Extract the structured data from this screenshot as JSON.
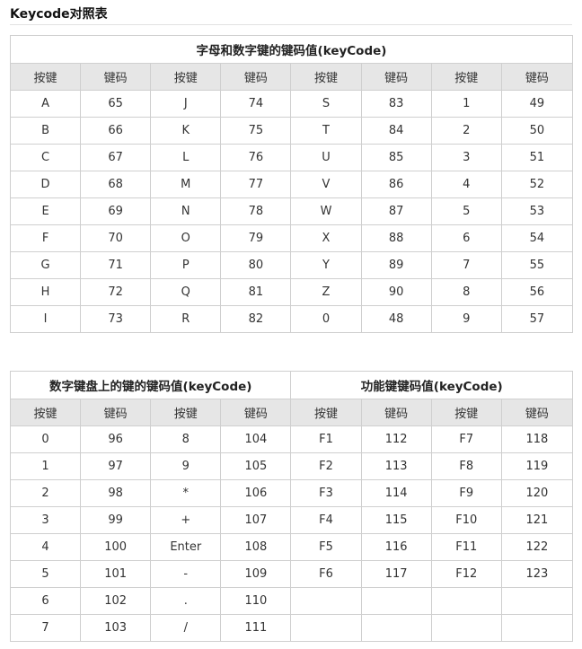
{
  "page_title": "Keycode对照表",
  "table1": {
    "caption": "字母和数字键的键码值(keyCode)",
    "headers": [
      "按键",
      "键码",
      "按键",
      "键码",
      "按键",
      "键码",
      "按键",
      "键码"
    ],
    "rows": [
      [
        "A",
        "65",
        "J",
        "74",
        "S",
        "83",
        "1",
        "49"
      ],
      [
        "B",
        "66",
        "K",
        "75",
        "T",
        "84",
        "2",
        "50"
      ],
      [
        "C",
        "67",
        "L",
        "76",
        "U",
        "85",
        "3",
        "51"
      ],
      [
        "D",
        "68",
        "M",
        "77",
        "V",
        "86",
        "4",
        "52"
      ],
      [
        "E",
        "69",
        "N",
        "78",
        "W",
        "87",
        "5",
        "53"
      ],
      [
        "F",
        "70",
        "O",
        "79",
        "X",
        "88",
        "6",
        "54"
      ],
      [
        "G",
        "71",
        "P",
        "80",
        "Y",
        "89",
        "7",
        "55"
      ],
      [
        "H",
        "72",
        "Q",
        "81",
        "Z",
        "90",
        "8",
        "56"
      ],
      [
        "I",
        "73",
        "R",
        "82",
        "0",
        "48",
        "9",
        "57"
      ]
    ]
  },
  "table2": {
    "caption_left": "数字键盘上的键的键码值(keyCode)",
    "caption_right": "功能键键码值(keyCode)",
    "headers": [
      "按键",
      "键码",
      "按键",
      "键码",
      "按键",
      "键码",
      "按键",
      "键码"
    ],
    "rows": [
      [
        "0",
        "96",
        "8",
        "104",
        "F1",
        "112",
        "F7",
        "118"
      ],
      [
        "1",
        "97",
        "9",
        "105",
        "F2",
        "113",
        "F8",
        "119"
      ],
      [
        "2",
        "98",
        "*",
        "106",
        "F3",
        "114",
        "F9",
        "120"
      ],
      [
        "3",
        "99",
        "+",
        "107",
        "F4",
        "115",
        "F10",
        "121"
      ],
      [
        "4",
        "100",
        "Enter",
        "108",
        "F5",
        "116",
        "F11",
        "122"
      ],
      [
        "5",
        "101",
        "-",
        "109",
        "F6",
        "117",
        "F12",
        "123"
      ],
      [
        "6",
        "102",
        ".",
        "110",
        "",
        "",
        "",
        ""
      ],
      [
        "7",
        "103",
        "/",
        "111",
        "",
        "",
        "",
        ""
      ]
    ]
  }
}
